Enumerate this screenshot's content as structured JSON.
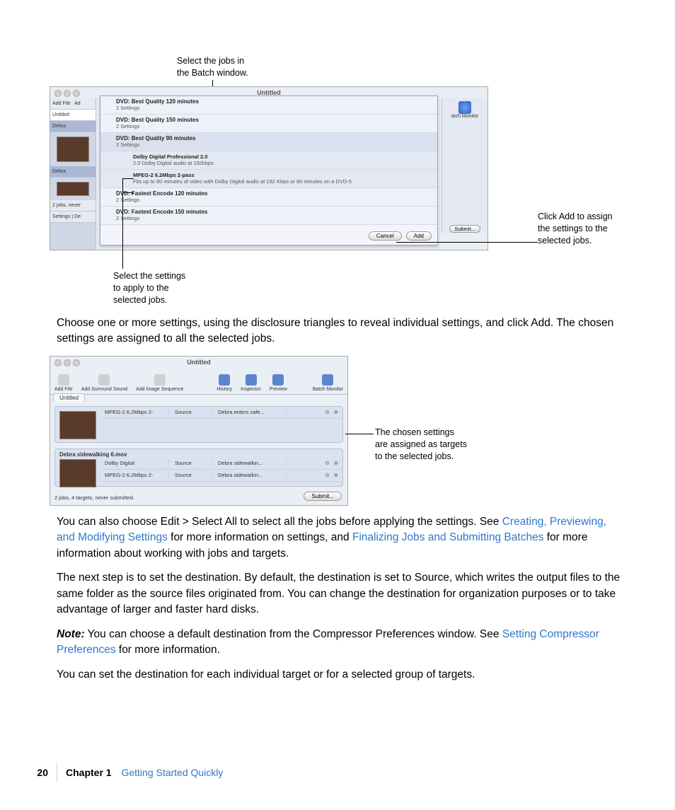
{
  "callouts": {
    "top": "Select the jobs in\nthe Batch window.",
    "right1": "Click Add to assign\nthe settings to the\nselected jobs.",
    "bottom1": "Select the settings\nto apply to the\nselected jobs.",
    "right2": "The chosen settings\nare assigned as targets\nto the selected jobs."
  },
  "fig1": {
    "title": "Untitled",
    "left": {
      "addFile": "Add File",
      "ad": "Ad",
      "tab": "Untitled",
      "debra1": "Debra",
      "debra2": "Debra",
      "status": "2 jobs, never",
      "settings": "Settings",
      "de": "De"
    },
    "right": {
      "batchMonitor": "atch Monitor",
      "submit": "Submit..."
    },
    "rows": [
      {
        "title": "DVD: Best Quality 120 minutes",
        "sub": "2 Settings"
      },
      {
        "title": "DVD: Best Quality 150 minutes",
        "sub": "2 Settings"
      },
      {
        "title": "DVD: Best Quality 90 minutes",
        "sub": "2 Settings",
        "expanded": true
      },
      {
        "title": "Dolby Digital Professional 2.0",
        "sub": "2.0 Dolby Digital audio at 192kbps",
        "indent": true
      },
      {
        "title": "MPEG-2 6.2Mbps 2-pass",
        "sub": "Fits up to 90 minutes of video with Dolby Digital audio at 192 Kbps or 60 minutes on a DVD-5",
        "indent": true
      },
      {
        "title": "DVD: Fastest Encode 120 minutes",
        "sub": "2 Settings"
      },
      {
        "title": "DVD: Fastest Encode 150 minutes",
        "sub": "2 Settings"
      }
    ],
    "buttons": {
      "cancel": "Cancel",
      "add": "Add"
    }
  },
  "fig2": {
    "title": "Untitled",
    "tools": [
      "Add File",
      "Add Surround Sound",
      "Add Image Sequence",
      "History",
      "Inspector",
      "Preview",
      "Batch Monitor"
    ],
    "tab": "Untitled",
    "job1": {
      "targets": [
        {
          "setting": "MPEG-2 6.2Mbps 2-",
          "dest": "Source",
          "out": "Debra enters cafe..."
        }
      ]
    },
    "job2": {
      "name": "Debra sidewalking 6.mov",
      "targets": [
        {
          "setting": "Dolby Digital",
          "dest": "Source",
          "out": "Debra sidewalkin..."
        },
        {
          "setting": "MPEG-2 6.2Mbps 2-",
          "dest": "Source",
          "out": "Debra sidewalkin..."
        }
      ]
    },
    "status": "2 jobs, 4 targets, never submitted.",
    "submit": "Submit..."
  },
  "paragraphs": {
    "p1": "Choose one or more settings, using the disclosure triangles to reveal individual settings, and click Add. The chosen settings are assigned to all the selected jobs.",
    "p2a": "You can also choose Edit > Select All to select all the jobs before applying the settings. See ",
    "p2link1": "Creating, Previewing, and Modifying Settings",
    "p2b": " for more information on settings, and ",
    "p2link2": "Finalizing Jobs and Submitting Batches",
    "p2c": " for more information about working with jobs and targets.",
    "p3": "The next step is to set the destination. By default, the destination is set to Source, which writes the output files to the same folder as the source files originated from. You can change the destination for organization purposes or to take advantage of larger and faster hard disks.",
    "p4note": "Note:",
    "p4a": "  You can choose a default destination from the Compressor Preferences window. See ",
    "p4link": "Setting Compressor Preferences",
    "p4b": " for more information.",
    "p5": "You can set the destination for each individual target or for a selected group of targets."
  },
  "footer": {
    "page": "20",
    "chapterLabel": "Chapter 1",
    "chapterTitle": "Getting Started Quickly"
  }
}
